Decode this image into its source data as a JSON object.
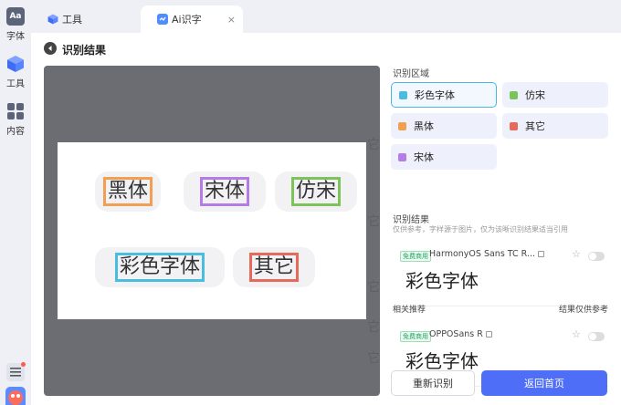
{
  "rail": {
    "items": [
      {
        "label": "字体",
        "icon": "font-aa-icon"
      },
      {
        "label": "工具",
        "icon": "cube-icon"
      },
      {
        "label": "内容",
        "icon": "grid-icon"
      }
    ],
    "logo_text": "Aa"
  },
  "tabs": [
    {
      "label": "工具",
      "icon": "cube-icon"
    },
    {
      "label": "Ai识字",
      "icon": "ai-icon",
      "active": true,
      "close": "×"
    }
  ],
  "page": {
    "title": "识别结果"
  },
  "preview": {
    "ghost_texts": [
      "它",
      "它",
      "它",
      "它",
      "它"
    ],
    "chips": [
      {
        "text": "黑体",
        "color": "#f0a050"
      },
      {
        "text": "宋体",
        "color": "#b47de6"
      },
      {
        "text": "仿宋",
        "color": "#7cc45a"
      },
      {
        "text": "彩色字体",
        "color": "#49bde0"
      },
      {
        "text": "其它",
        "color": "#e66a5a"
      }
    ]
  },
  "regions": {
    "heading": "识别区域",
    "items": [
      {
        "label": "彩色字体",
        "color": "#49bde0",
        "selected": true
      },
      {
        "label": "仿宋",
        "color": "#7cc45a"
      },
      {
        "label": "黑体",
        "color": "#f0a050"
      },
      {
        "label": "其它",
        "color": "#e66a5a"
      },
      {
        "label": "宋体",
        "color": "#b47de6"
      }
    ]
  },
  "results": {
    "heading": "识别结果",
    "hint": "仅供参考，字样源于图片，仅为该晰识别结果适当引用",
    "primary": {
      "badge": "免费商用",
      "font_name": "HarmonyOS Sans TC R...",
      "sample": "彩色字体"
    },
    "related_heading": "相关推荐",
    "related_note": "结果仅供参考",
    "related": [
      {
        "badge": "免费商用",
        "font_name": "OPPOSans R",
        "sample": "彩色字体"
      }
    ]
  },
  "buttons": {
    "retry": "重新识别",
    "home": "返回首页"
  },
  "colors": {
    "accent": "#4f6ef7",
    "select_border": "#49b8e0"
  }
}
